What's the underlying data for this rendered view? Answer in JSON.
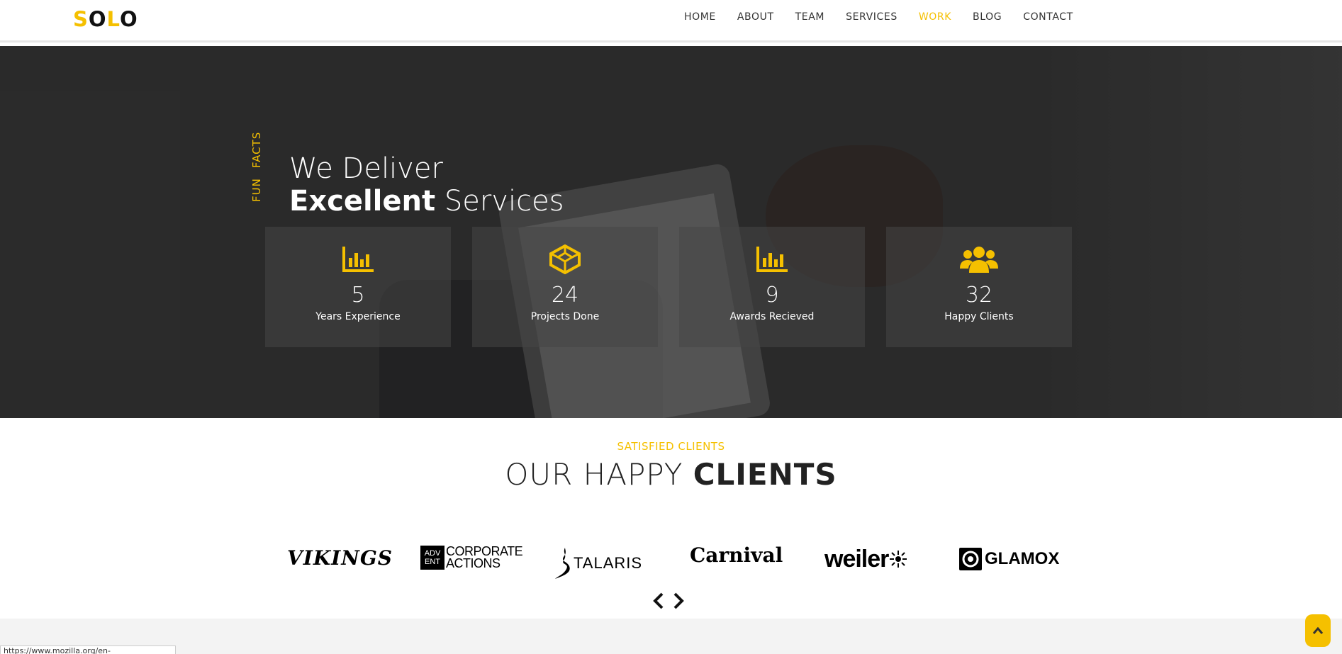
{
  "header": {
    "logo_letters": [
      "S",
      "O",
      "L",
      "O"
    ],
    "nav": [
      {
        "label": "HOME"
      },
      {
        "label": "ABOUT"
      },
      {
        "label": "TEAM"
      },
      {
        "label": "SERVICES"
      },
      {
        "label": "WORK",
        "active": true
      },
      {
        "label": "BLOG"
      },
      {
        "label": "CONTACT"
      }
    ]
  },
  "hero": {
    "vertical_label_1": "FUN",
    "vertical_label_2": "FACTS",
    "title_line1": "We Deliver",
    "title_bold": "Excellent",
    "title_rest": " Services",
    "stats": [
      {
        "icon": "bar-chart-icon",
        "number": "5",
        "label": "Years Experience"
      },
      {
        "icon": "cube-icon",
        "number": "24",
        "label": "Projects Done"
      },
      {
        "icon": "bar-chart-icon",
        "number": "9",
        "label": "Awards Recieved"
      },
      {
        "icon": "users-icon",
        "number": "32",
        "label": "Happy Clients"
      }
    ]
  },
  "clients": {
    "eyebrow": "SATISFIED CLIENTS",
    "title_light": "OUR HAPPY ",
    "title_bold": "CLIENTS",
    "logos": {
      "vikings": "VIKINGS",
      "advent_box_1": "ADV",
      "advent_box_2": "ENT",
      "advent_text_1": "CORPORATE",
      "advent_text_2": "ACTIONS",
      "talaris": "TALARIS",
      "carnival": "Carnival",
      "weiler": "weiler",
      "glamox": "GLAMOX"
    }
  },
  "status_bar": {
    "url": "https://www.mozilla.org/en-US/firefox/central/"
  },
  "colors": {
    "accent": "#f5c000",
    "dark": "#222222"
  }
}
